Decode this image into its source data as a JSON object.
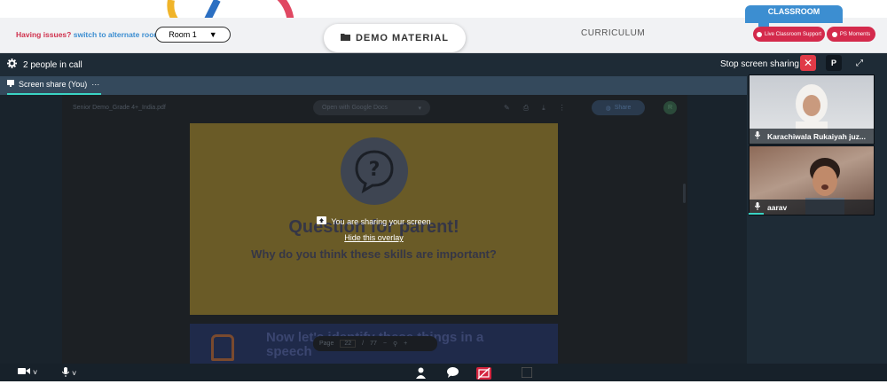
{
  "header": {
    "issues_text": "Having issues?",
    "switch_link": "switch to alternate room",
    "room_select_value": "Room 1",
    "demo_material_label": "DEMO MATERIAL",
    "curriculum_label": "CURRICULUM",
    "classroom_tab": "CLASSROOM",
    "live_support_label": "Live Classroom Support",
    "ps_moments_label": "PS Moments"
  },
  "call": {
    "people_count": "2 people in call",
    "stop_share_label": "Stop screen sharing",
    "p_label": "P",
    "screen_share_tab": "Screen share (You)",
    "tab_more": "···"
  },
  "viewer": {
    "pdf_name": "Senior Demo_Grade 4+_India.pdf",
    "open_with": "Open with Google Docs",
    "share_label": "Share",
    "avatar_initial": "R",
    "page_label": "Page",
    "page_current": "22",
    "page_sep": "/",
    "page_total": "77"
  },
  "slide": {
    "title": "Question for parent!",
    "question": "Why do you think these skills are important?",
    "next_title": "Now let's identify these things in a speech"
  },
  "overlay": {
    "sharing_text": "You are sharing your screen",
    "hide_link": "Hide this overlay"
  },
  "participants": [
    {
      "name": "Karachiwala Rukaiyah juz..."
    },
    {
      "name": "aarav"
    }
  ],
  "colors": {
    "accent_red": "#d42a4c",
    "accent_blue": "#3c8ed1",
    "call_bg": "#1e2b36",
    "speaking": "#3ad4c4"
  }
}
